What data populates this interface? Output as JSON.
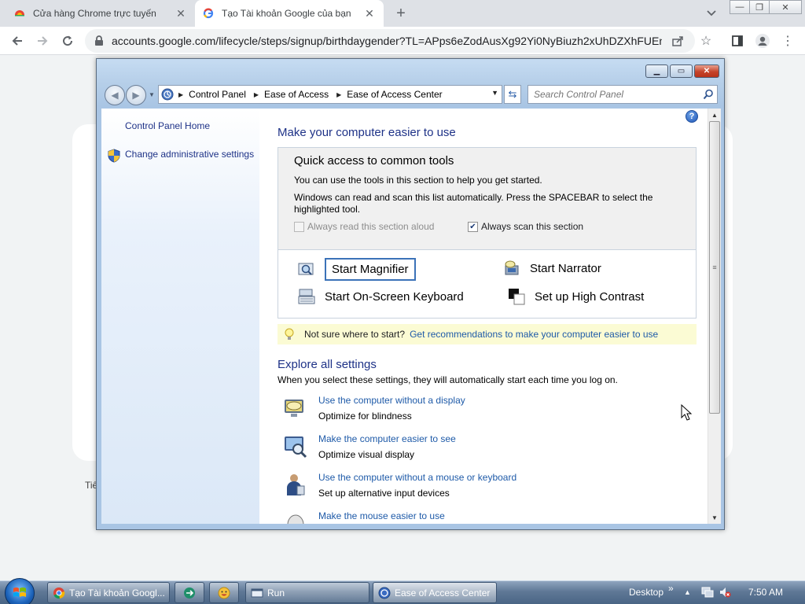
{
  "browser": {
    "tabs": [
      {
        "title": "Cửa hàng Chrome trực tuyến"
      },
      {
        "title": "Tạo Tài khoản Google của bạn"
      }
    ],
    "url": "accounts.google.com/lifecycle/steps/signup/birthdaygender?TL=APps6eZodAusXg92Yi0NyBiuzh2xUhDZXhFUEn..."
  },
  "page": {
    "footer_fragment": "Tiế"
  },
  "explorer": {
    "breadcrumb": [
      "Control Panel",
      "Ease of Access",
      "Ease of Access Center"
    ],
    "search_placeholder": "Search Control Panel",
    "left_pane": {
      "links": [
        "Control Panel Home",
        "Change administrative settings"
      ]
    },
    "main": {
      "heading": "Make your computer easier to use",
      "quick": {
        "title": "Quick access to common tools",
        "line1": "You can use the tools in this section to help you get started.",
        "line2": "Windows can read and scan this list automatically.  Press the SPACEBAR to select the highlighted tool.",
        "check_read_aloud": "Always read this section aloud",
        "check_scan": "Always scan this section",
        "check_read_aloud_checked": false,
        "check_scan_checked": true,
        "tools": {
          "magnifier": "Start Magnifier",
          "narrator": "Start Narrator",
          "keyboard": "Start On-Screen Keyboard",
          "contrast": "Set up High Contrast"
        }
      },
      "tip": {
        "text": "Not sure where to start?",
        "link": "Get recommendations to make your computer easier to use"
      },
      "explore": {
        "heading": "Explore all settings",
        "sub": "When you select these settings, they will automatically start each time you log on.",
        "items": [
          {
            "link": "Use the computer without a display",
            "desc": "Optimize for blindness"
          },
          {
            "link": "Make the computer easier to see",
            "desc": "Optimize visual display"
          },
          {
            "link": "Use the computer without a mouse or keyboard",
            "desc": "Set up alternative input devices"
          },
          {
            "link": "Make the mouse easier to use",
            "desc": ""
          }
        ]
      }
    }
  },
  "taskbar": {
    "items": [
      "Tạo Tài khoản Googl...",
      "Run",
      "Ease of Access Center"
    ],
    "desktop_label": "Desktop",
    "clock": "7:50 AM"
  }
}
